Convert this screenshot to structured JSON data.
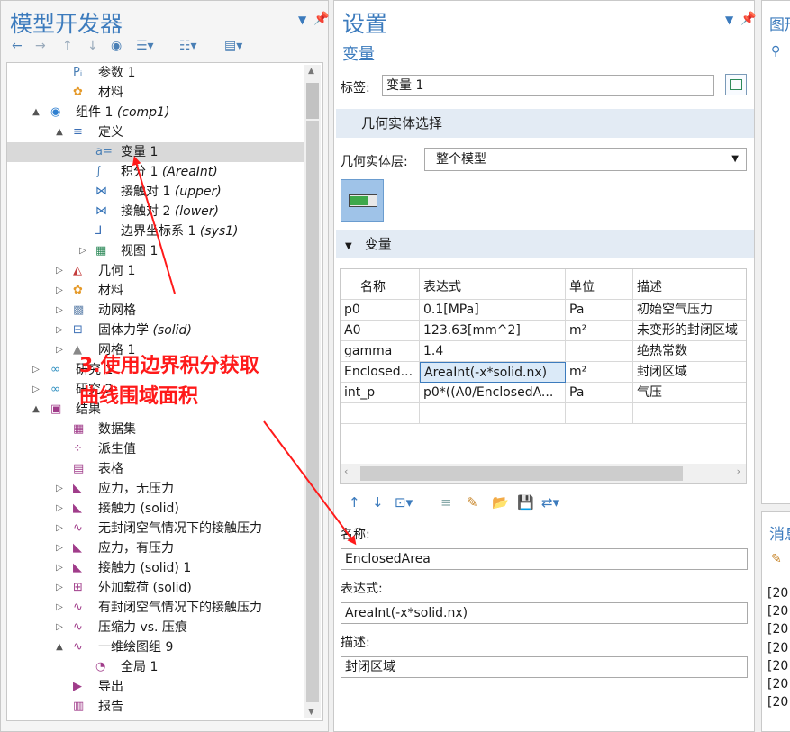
{
  "left_panel": {
    "title": "模型开发器",
    "toolbar_icons": [
      "back-icon",
      "forward-icon",
      "up-icon",
      "down-icon",
      "show-icon",
      "expand-menu-icon",
      "collapse-menu-icon",
      "list-menu-icon"
    ],
    "tree": [
      {
        "label": "参数 1",
        "italic": "",
        "level": 3,
        "arrow": "",
        "icon": "parameter-icon"
      },
      {
        "label": "材料",
        "italic": "",
        "level": 3,
        "arrow": "",
        "icon": "materials-icon"
      },
      {
        "label": "组件 1 ",
        "italic": "(comp1)",
        "level": 2,
        "arrow": "▲",
        "icon": "component-icon"
      },
      {
        "label": "定义",
        "italic": "",
        "level": 3,
        "arrow": "▲",
        "icon": "definitions-icon"
      },
      {
        "label": "变量 1",
        "italic": "",
        "level": 4,
        "arrow": "",
        "icon": "variables-icon",
        "selected": true
      },
      {
        "label": "积分 1 ",
        "italic": "(AreaInt)",
        "level": 4,
        "arrow": "",
        "icon": "integration-icon"
      },
      {
        "label": "接触对 1 ",
        "italic": "(upper)",
        "level": 4,
        "arrow": "",
        "icon": "contact-pair-icon"
      },
      {
        "label": "接触对 2 ",
        "italic": "(lower)",
        "level": 4,
        "arrow": "",
        "icon": "contact-pair-icon"
      },
      {
        "label": "边界坐标系 1 ",
        "italic": "(sys1)",
        "level": 4,
        "arrow": "",
        "icon": "coordinate-system-icon"
      },
      {
        "label": "视图 1",
        "italic": "",
        "level": 4,
        "arrow": "▷",
        "icon": "view-icon"
      },
      {
        "label": "几何 1",
        "italic": "",
        "level": 3,
        "arrow": "▷",
        "icon": "geometry-icon"
      },
      {
        "label": "材料",
        "italic": "",
        "level": 3,
        "arrow": "▷",
        "icon": "materials-icon"
      },
      {
        "label": "动网格",
        "italic": "",
        "level": 3,
        "arrow": "▷",
        "icon": "moving-mesh-icon"
      },
      {
        "label": "固体力学 ",
        "italic": "(solid)",
        "level": 3,
        "arrow": "▷",
        "icon": "solid-mechanics-icon"
      },
      {
        "label": "网格 1",
        "italic": "",
        "level": 3,
        "arrow": "▷",
        "icon": "mesh-icon"
      },
      {
        "label": "研究 1",
        "italic": "",
        "level": 2,
        "arrow": "▷",
        "icon": "study-icon"
      },
      {
        "label": "研究 2",
        "italic": "",
        "level": 2,
        "arrow": "▷",
        "icon": "study-icon"
      },
      {
        "label": "结果",
        "italic": "",
        "level": 2,
        "arrow": "▲",
        "icon": "results-icon"
      },
      {
        "label": "数据集",
        "italic": "",
        "level": 3,
        "arrow": "",
        "icon": "datasets-icon"
      },
      {
        "label": "派生值",
        "italic": "",
        "level": 3,
        "arrow": "",
        "icon": "derived-values-icon"
      },
      {
        "label": "表格",
        "italic": "",
        "level": 3,
        "arrow": "",
        "icon": "table-icon"
      },
      {
        "label": "应力，无压力",
        "italic": "",
        "level": 3,
        "arrow": "▷",
        "icon": "plot-group-icon"
      },
      {
        "label": "接触力 (solid)",
        "italic": "",
        "level": 3,
        "arrow": "▷",
        "icon": "plot-group-icon"
      },
      {
        "label": "无封闭空气情况下的接触压力",
        "italic": "",
        "level": 3,
        "arrow": "▷",
        "icon": "line-plot-icon"
      },
      {
        "label": "应力，有压力",
        "italic": "",
        "level": 3,
        "arrow": "▷",
        "icon": "plot-group-icon"
      },
      {
        "label": "接触力 (solid) 1",
        "italic": "",
        "level": 3,
        "arrow": "▷",
        "icon": "plot-group-icon"
      },
      {
        "label": "外加载荷 (solid)",
        "italic": "",
        "level": 3,
        "arrow": "▷",
        "icon": "load-plot-icon"
      },
      {
        "label": "有封闭空气情况下的接触压力",
        "italic": "",
        "level": 3,
        "arrow": "▷",
        "icon": "line-plot-icon"
      },
      {
        "label": "压缩力 vs. 压痕",
        "italic": "",
        "level": 3,
        "arrow": "▷",
        "icon": "line-plot-icon"
      },
      {
        "label": "一维绘图组 9",
        "italic": "",
        "level": 3,
        "arrow": "▲",
        "icon": "line-plot-icon"
      },
      {
        "label": "全局 1",
        "italic": "",
        "level": 4,
        "arrow": "",
        "icon": "global-plot-icon"
      },
      {
        "label": "导出",
        "italic": "",
        "level": 3,
        "arrow": "",
        "icon": "export-icon"
      },
      {
        "label": "报告",
        "italic": "",
        "level": 3,
        "arrow": "",
        "icon": "report-icon"
      }
    ]
  },
  "annotation": {
    "line1": "3.使用边界积分获取",
    "line2": "曲线围域面积",
    "color": "#ff1a1a"
  },
  "settings": {
    "title": "设置",
    "subtitle": "变量",
    "label_caption": "标签:",
    "label_value": "变量 1",
    "geom_section": "几何实体选择",
    "geom_level_caption": "几何实体层:",
    "geom_level_value": "整个模型",
    "var_section": "变量",
    "table": {
      "headers": [
        "名称",
        "表达式",
        "单位",
        "描述"
      ],
      "rows": [
        [
          "p0",
          "0.1[MPa]",
          "Pa",
          "初始空气压力"
        ],
        [
          "A0",
          "123.63[mm^2]",
          "m²",
          "未变形的封闭区域"
        ],
        [
          "gamma",
          "1.4",
          "",
          "绝热常数"
        ],
        [
          "Enclosed...",
          "AreaInt(-x*solid.nx)",
          "m²",
          "封闭区域"
        ],
        [
          "int_p",
          "p0*((A0/EnclosedA...",
          "Pa",
          "气压"
        ],
        [
          "",
          "",
          "",
          ""
        ]
      ]
    },
    "name_caption": "名称:",
    "name_value": "EnclosedArea",
    "expr_caption": "表达式:",
    "expr_value": "AreaInt(-x*solid.nx)",
    "desc_caption": "描述:",
    "desc_value": "封闭区域"
  },
  "right_panel": {
    "title": "图形",
    "messages_title": "消息",
    "log_lines": [
      "[20",
      "[20",
      "[20",
      "[20",
      "[20",
      "[20",
      "[20"
    ]
  }
}
